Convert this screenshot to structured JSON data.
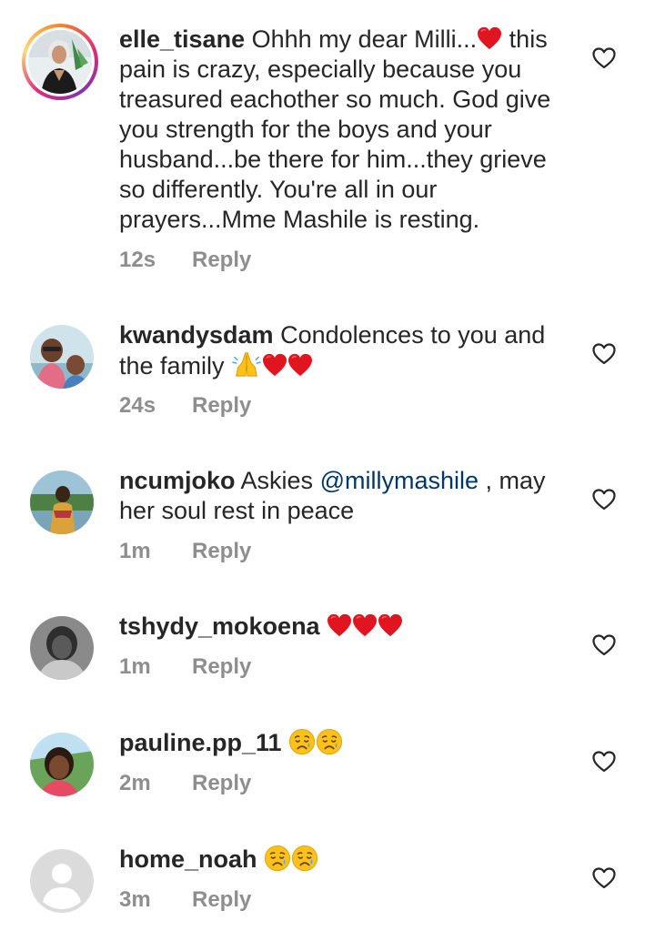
{
  "comments": [
    {
      "username": "elle_tisane",
      "text_before_emoji": " Ohhh my dear Milli...",
      "emoji": "red-heart",
      "text_after_emoji": " this pain is crazy, especially because you treasured eachother so much. God give you strength for the boys and your husband...be there for him...they grieve so differently. You're all in our prayers...Mme Mashile is resting.",
      "time": "12s",
      "reply": "Reply",
      "has_story_ring": true
    },
    {
      "username": "kwandysdam",
      "text": " Condolences to you and the family ",
      "emojis": [
        "folded-hands",
        "red-heart",
        "red-heart"
      ],
      "time": "24s",
      "reply": "Reply"
    },
    {
      "username": "ncumjoko",
      "text_before_mention": " Askies ",
      "mention": "@millymashile",
      "text_after_mention": " , may her soul rest in peace",
      "time": "1m",
      "reply": "Reply"
    },
    {
      "username": "tshydy_mokoena",
      "text": " ",
      "emojis": [
        "red-heart",
        "red-heart",
        "red-heart"
      ],
      "time": "1m",
      "reply": "Reply"
    },
    {
      "username": "pauline.pp_11",
      "text": " ",
      "emojis": [
        "crying-face",
        "crying-face"
      ],
      "time": "2m",
      "reply": "Reply"
    },
    {
      "username": "home_noah",
      "text": " ",
      "emojis": [
        "crying-face",
        "crying-face"
      ],
      "time": "3m",
      "reply": "Reply"
    }
  ],
  "colors": {
    "text": "#262626",
    "meta": "#8e8e8e",
    "mention": "#00376b",
    "heart_emoji": "#e0151f"
  },
  "icons": {
    "like": "heart-outline-icon"
  }
}
